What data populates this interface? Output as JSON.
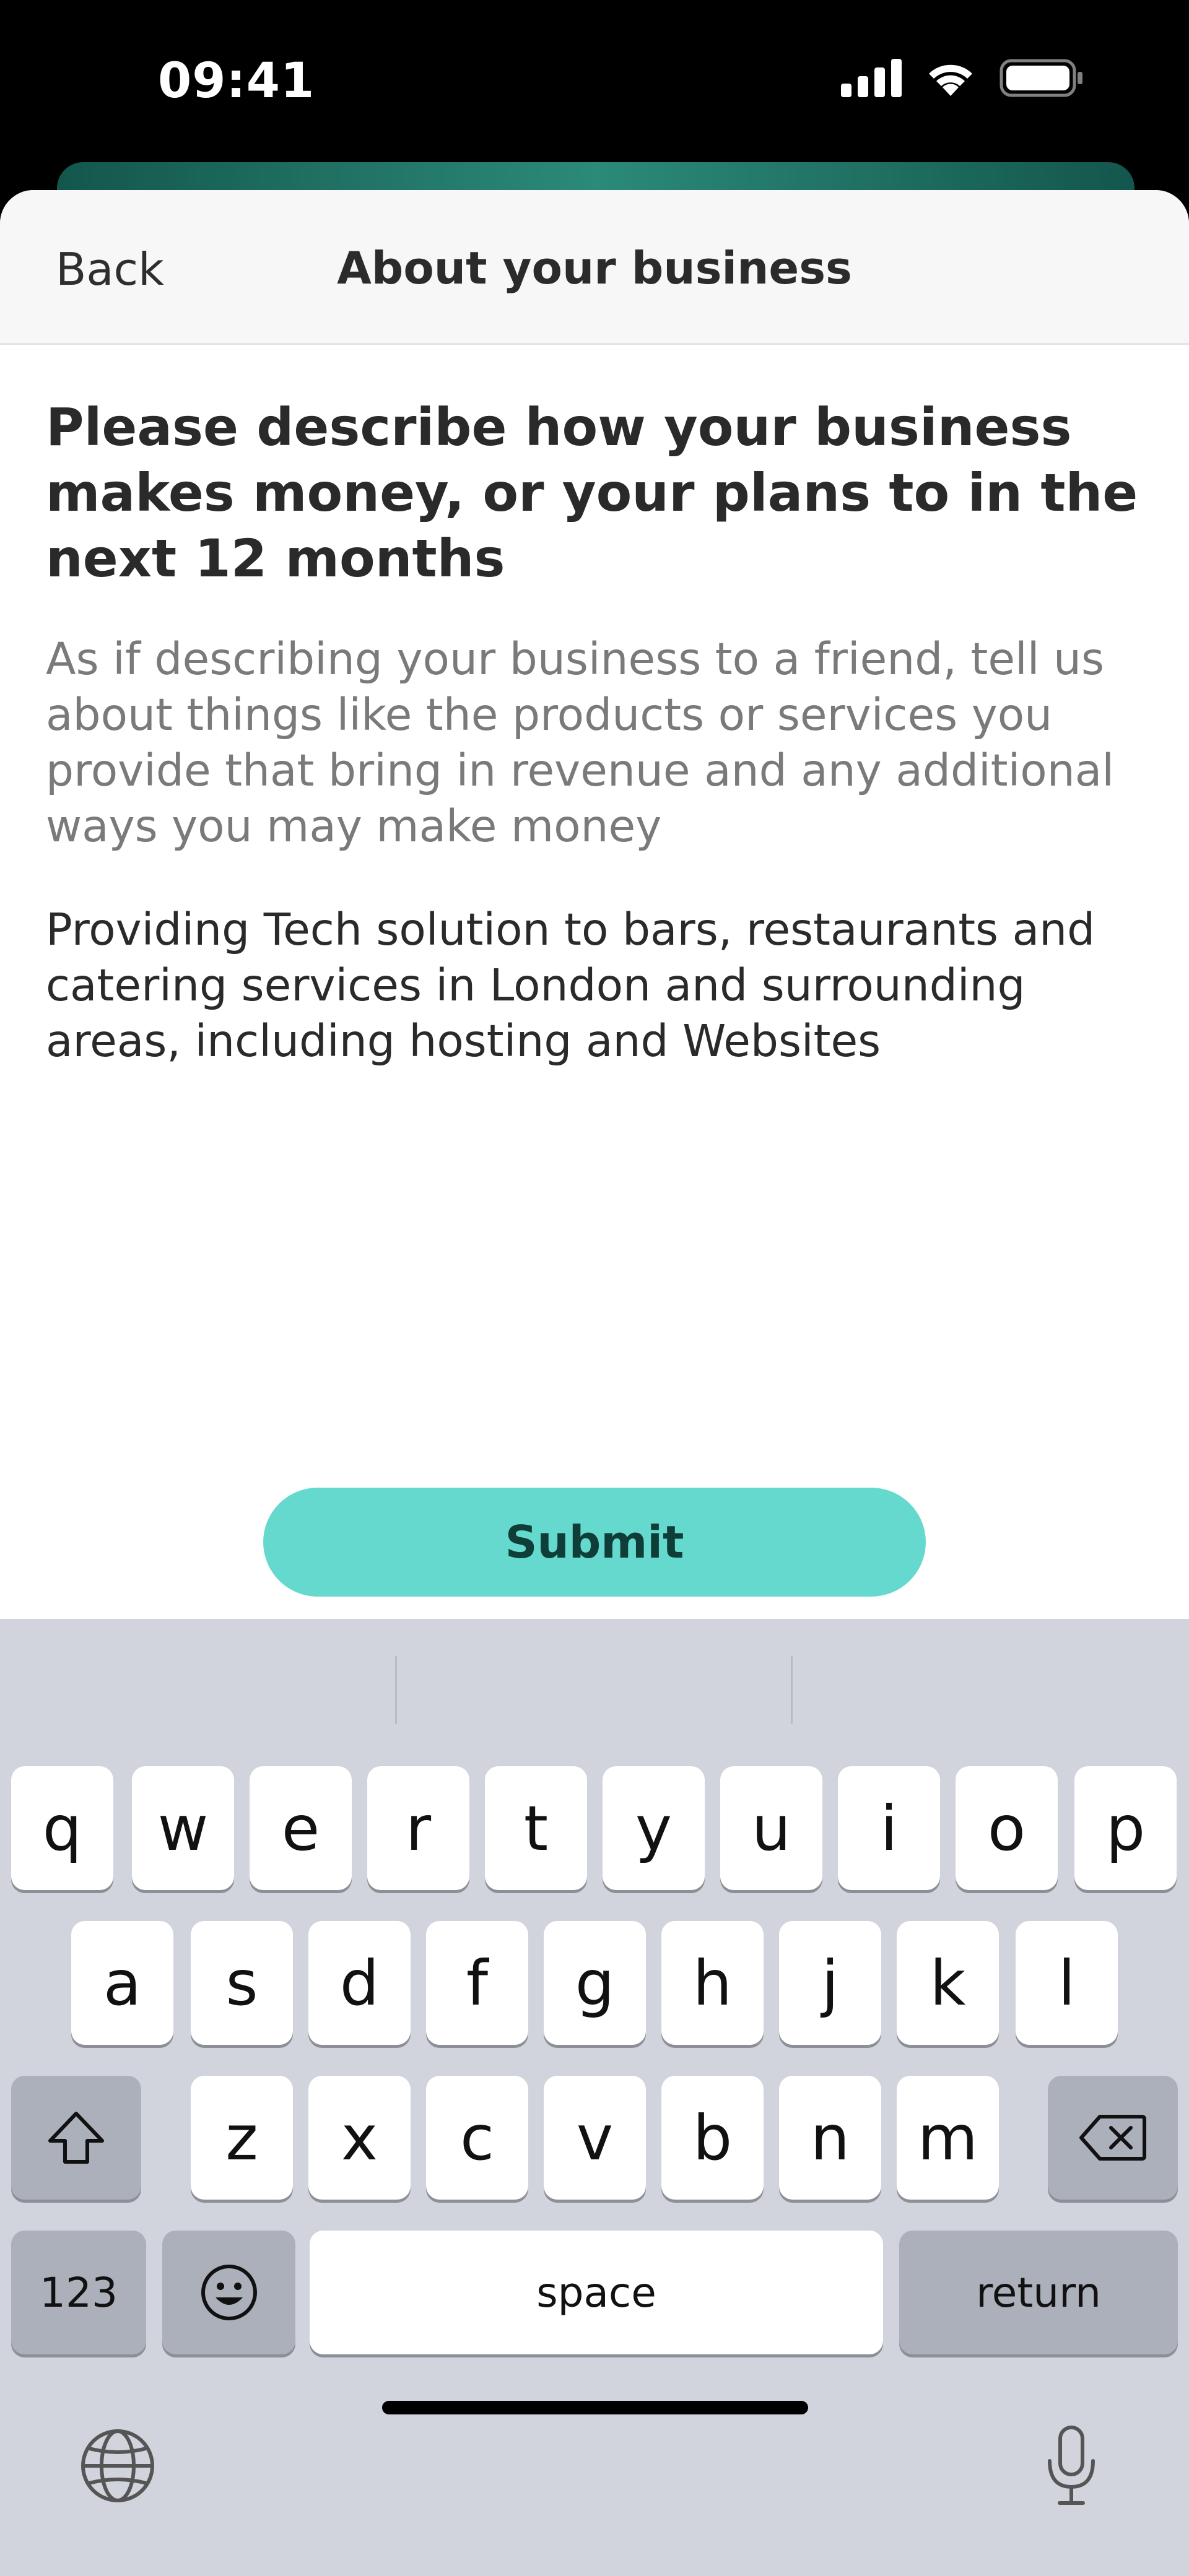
{
  "status_bar": {
    "time": "09:41",
    "icons": [
      "cellular-signal-icon",
      "wifi-icon",
      "battery-icon"
    ]
  },
  "nav": {
    "back_label": "Back",
    "title": "About your business"
  },
  "content": {
    "question": "Please describe how your business makes money, or your plans to in the next 12 months",
    "helper": "As if describing your business to a friend, tell us about things like the products or services you provide that bring in revenue and any additional ways you may make money",
    "answer": "Providing Tech solution to bars, restaurants and catering services in London and surrounding areas, including hosting and Websites"
  },
  "submit_label": "Submit",
  "colors": {
    "accent": "#66d9cf",
    "accent_text": "#0f3d37",
    "keyboard_bg": "#d1d4dc"
  },
  "keyboard": {
    "row1": [
      "q",
      "w",
      "e",
      "r",
      "t",
      "y",
      "u",
      "i",
      "o",
      "p"
    ],
    "row2": [
      "a",
      "s",
      "d",
      "f",
      "g",
      "h",
      "j",
      "k",
      "l"
    ],
    "row3": [
      "z",
      "x",
      "c",
      "v",
      "b",
      "n",
      "m"
    ],
    "numbers_label": "123",
    "space_label": "space",
    "return_label": "return",
    "icons": [
      "shift-icon",
      "delete-icon",
      "emoji-icon",
      "globe-icon",
      "microphone-icon"
    ]
  }
}
